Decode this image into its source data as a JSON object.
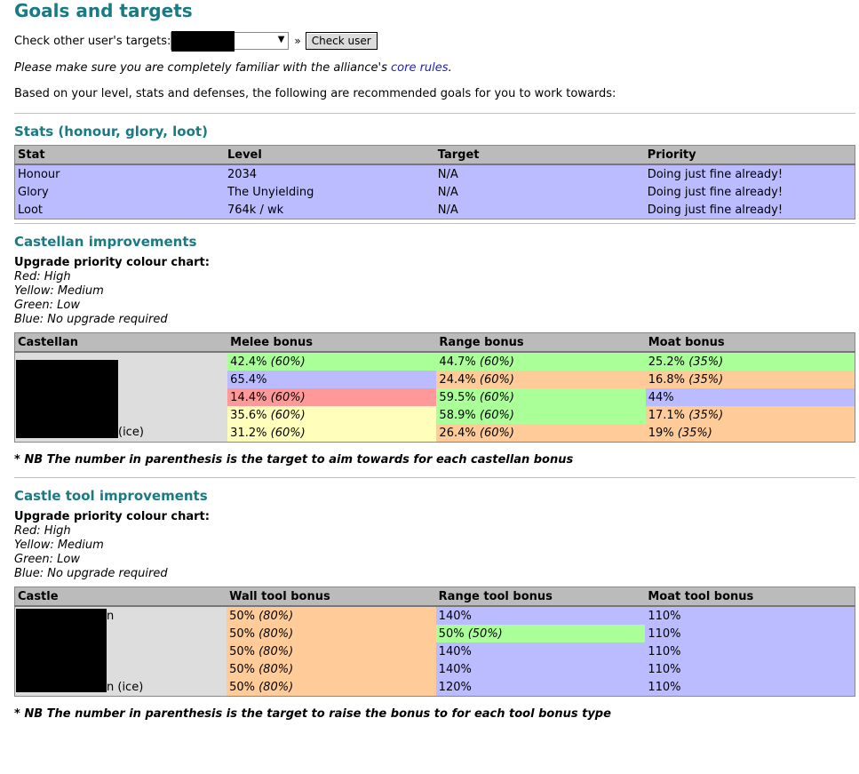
{
  "page_title": "Goals and targets",
  "check_other": {
    "label": "Check other user's targets:",
    "raquo": "»",
    "button_label": "Check user"
  },
  "notice": {
    "prefix": "Please make sure you are completely familiar with the alliance's ",
    "link": "core rules",
    "suffix": "."
  },
  "based_on": "Based on your level, stats and defenses, the following are recommended goals for you to work towards:",
  "stats": {
    "heading": "Stats (honour, glory, loot)",
    "headers": [
      "Stat",
      "Level",
      "Target",
      "Priority"
    ],
    "rows": [
      [
        "Honour",
        "2034",
        "N/A",
        "Doing just fine already!"
      ],
      [
        "Glory",
        "The Unyielding",
        "N/A",
        "Doing just fine already!"
      ],
      [
        "Loot",
        "764k / wk",
        "N/A",
        "Doing just fine already!"
      ]
    ]
  },
  "castellan": {
    "heading": "Castellan improvements",
    "legend_title": "Upgrade priority colour chart:",
    "legend": [
      "Red: High",
      "Yellow: Medium",
      "Green: Low",
      "Blue: No upgrade required"
    ],
    "headers": [
      "Castellan",
      "Melee bonus",
      "Range bonus",
      "Moat bonus"
    ],
    "rows": [
      {
        "name": "",
        "melee": [
          "42.4%",
          "(60%)"
        ],
        "range": [
          "44.7%",
          "(60%)"
        ],
        "moat": [
          "25.2%",
          "(35%)"
        ]
      },
      {
        "name": "",
        "melee": [
          "65.4%",
          ""
        ],
        "range": [
          "24.4%",
          "(60%)"
        ],
        "moat": [
          "16.8%",
          "(35%)"
        ]
      },
      {
        "name": "",
        "melee": [
          "14.4%",
          "(60%)"
        ],
        "range": [
          "59.5%",
          "(60%)"
        ],
        "moat": [
          "44%",
          ""
        ]
      },
      {
        "name": "",
        "melee": [
          "35.6%",
          "(60%)"
        ],
        "range": [
          "58.9%",
          "(60%)"
        ],
        "moat": [
          "17.1%",
          "(35%)"
        ]
      },
      {
        "name": "(ice)",
        "melee": [
          "31.2%",
          "(60%)"
        ],
        "range": [
          "26.4%",
          "(60%)"
        ],
        "moat": [
          "19%",
          "(35%)"
        ]
      }
    ],
    "note": "* NB The number in parenthesis is the target to aim towards for each castellan bonus"
  },
  "tools": {
    "heading": "Castle tool improvements",
    "legend_title": "Upgrade priority colour chart:",
    "legend": [
      "Red: High",
      "Yellow: Medium",
      "Green: Low",
      "Blue: No upgrade required"
    ],
    "headers": [
      "Castle",
      "Wall tool bonus",
      "Range tool bonus",
      "Moat tool bonus"
    ],
    "rows": [
      {
        "name": "n",
        "wall": [
          "50%",
          "(80%)"
        ],
        "range": [
          "140%",
          ""
        ],
        "moat": [
          "110%",
          ""
        ]
      },
      {
        "name": "",
        "wall": [
          "50%",
          "(80%)"
        ],
        "range": [
          "50%",
          "(50%)"
        ],
        "moat": [
          "110%",
          ""
        ]
      },
      {
        "name": "",
        "wall": [
          "50%",
          "(80%)"
        ],
        "range": [
          "140%",
          ""
        ],
        "moat": [
          "110%",
          ""
        ]
      },
      {
        "name": "",
        "wall": [
          "50%",
          "(80%)"
        ],
        "range": [
          "140%",
          ""
        ],
        "moat": [
          "110%",
          ""
        ]
      },
      {
        "name": "n (ice)",
        "wall": [
          "50%",
          "(80%)"
        ],
        "range": [
          "120%",
          ""
        ],
        "moat": [
          "110%",
          ""
        ]
      }
    ],
    "note": "* NB The number in parenthesis is the target to raise the bonus to for each tool bonus type"
  },
  "colors": {
    "heading": "#1a7a82",
    "blue": "#bbbbff",
    "green": "#aaff99",
    "yellow": "#ffffbb",
    "orange": "#ffcc99",
    "red": "#ff9999"
  }
}
